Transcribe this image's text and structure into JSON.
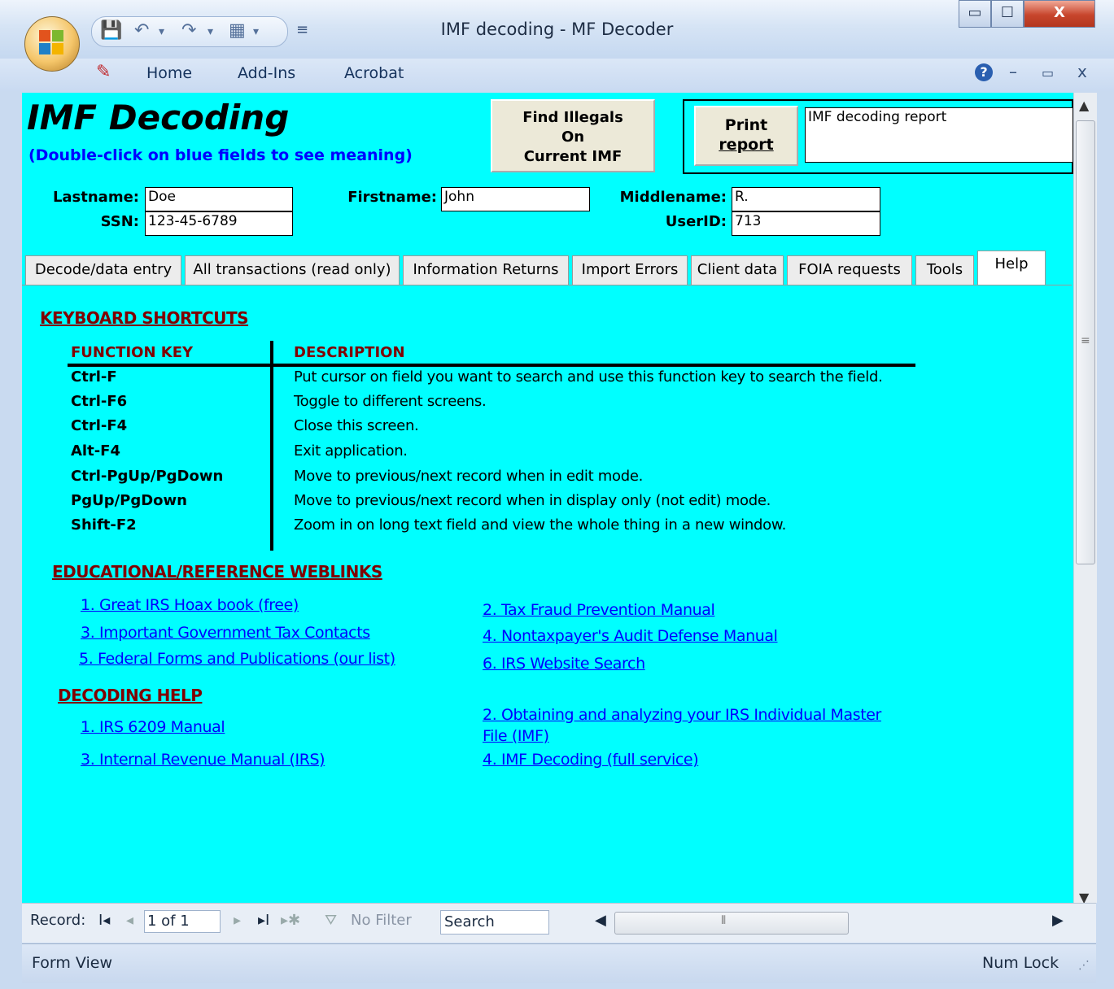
{
  "window": {
    "title": "IMF decoding - MF Decoder",
    "minimize": "▭",
    "maximize": "☐",
    "close": "X"
  },
  "ribbon": {
    "tabs": [
      "Home",
      "Add-Ins",
      "Acrobat"
    ],
    "help": "?",
    "min": "–",
    "restore": "▭",
    "close": "x"
  },
  "form": {
    "title": "IMF Decoding",
    "subtitle": "(Double-click on blue fields to see meaning)",
    "find_illegals_button": [
      "Find Illegals",
      "On",
      "Current IMF"
    ],
    "print_report_button": [
      "Print",
      "report"
    ],
    "report_name": "IMF decoding report",
    "fields": {
      "lastname_label": "Lastname:",
      "lastname": "Doe",
      "firstname_label": "Firstname:",
      "firstname": "John",
      "middlename_label": "Middlename:",
      "middlename": "R.",
      "ssn_label": "SSN:",
      "ssn": "123-45-6789",
      "userid_label": "UserID:",
      "userid": "713"
    },
    "tabs": [
      "Decode/data entry",
      "All transactions (read only)",
      "Information Returns",
      "Import Errors",
      "Client data",
      "FOIA requests",
      "Tools",
      "Help"
    ],
    "active_tab": "Help"
  },
  "help": {
    "shortcuts_heading": "KEYBOARD SHORTCUTS",
    "col_key": "FUNCTION KEY",
    "col_desc": "DESCRIPTION",
    "shortcuts": [
      {
        "key": "Ctrl-F",
        "desc": "Put cursor on field you want to search and use this function key to search the field."
      },
      {
        "key": "Ctrl-F6",
        "desc": "Toggle to different screens."
      },
      {
        "key": "Ctrl-F4",
        "desc": "Close this screen."
      },
      {
        "key": "Alt-F4",
        "desc": "Exit application."
      },
      {
        "key": "Ctrl-PgUp/PgDown",
        "desc": "Move to previous/next record when in edit mode."
      },
      {
        "key": "PgUp/PgDown",
        "desc": "Move to previous/next record when in display only (not edit) mode."
      },
      {
        "key": "Shift-F2",
        "desc": "Zoom in on long text field and view the whole thing in a new window."
      }
    ],
    "weblinks_heading": "EDUCATIONAL/REFERENCE WEBLINKS",
    "weblinks": [
      "1.  Great IRS Hoax book (free)",
      "2.  Tax Fraud Prevention Manual",
      "3.  Important Government Tax Contacts",
      "4.  Nontaxpayer's Audit Defense Manual",
      "5. Federal Forms and Publications (our list)",
      "6.  IRS Website Search"
    ],
    "decoding_heading": "DECODING HELP",
    "decoding_links": [
      "1.  IRS 6209 Manual",
      "2.  Obtaining and analyzing your IRS Individual  Master",
      "File (IMF)",
      "3.  Internal Revenue Manual (IRS)",
      "4.  IMF Decoding (full service)"
    ]
  },
  "record_nav": {
    "label": "Record:",
    "first": "I◂",
    "prev": "◂",
    "position": "1 of 1",
    "next": "▸",
    "last": "▸I",
    "new": "▸✱",
    "filter": "No Filter",
    "search": "Search"
  },
  "status": {
    "view": "Form View",
    "numlock": "Num Lock"
  },
  "colors": {
    "form_bg": "#00ffff",
    "heading": "#800000",
    "link": "#0000ff"
  }
}
